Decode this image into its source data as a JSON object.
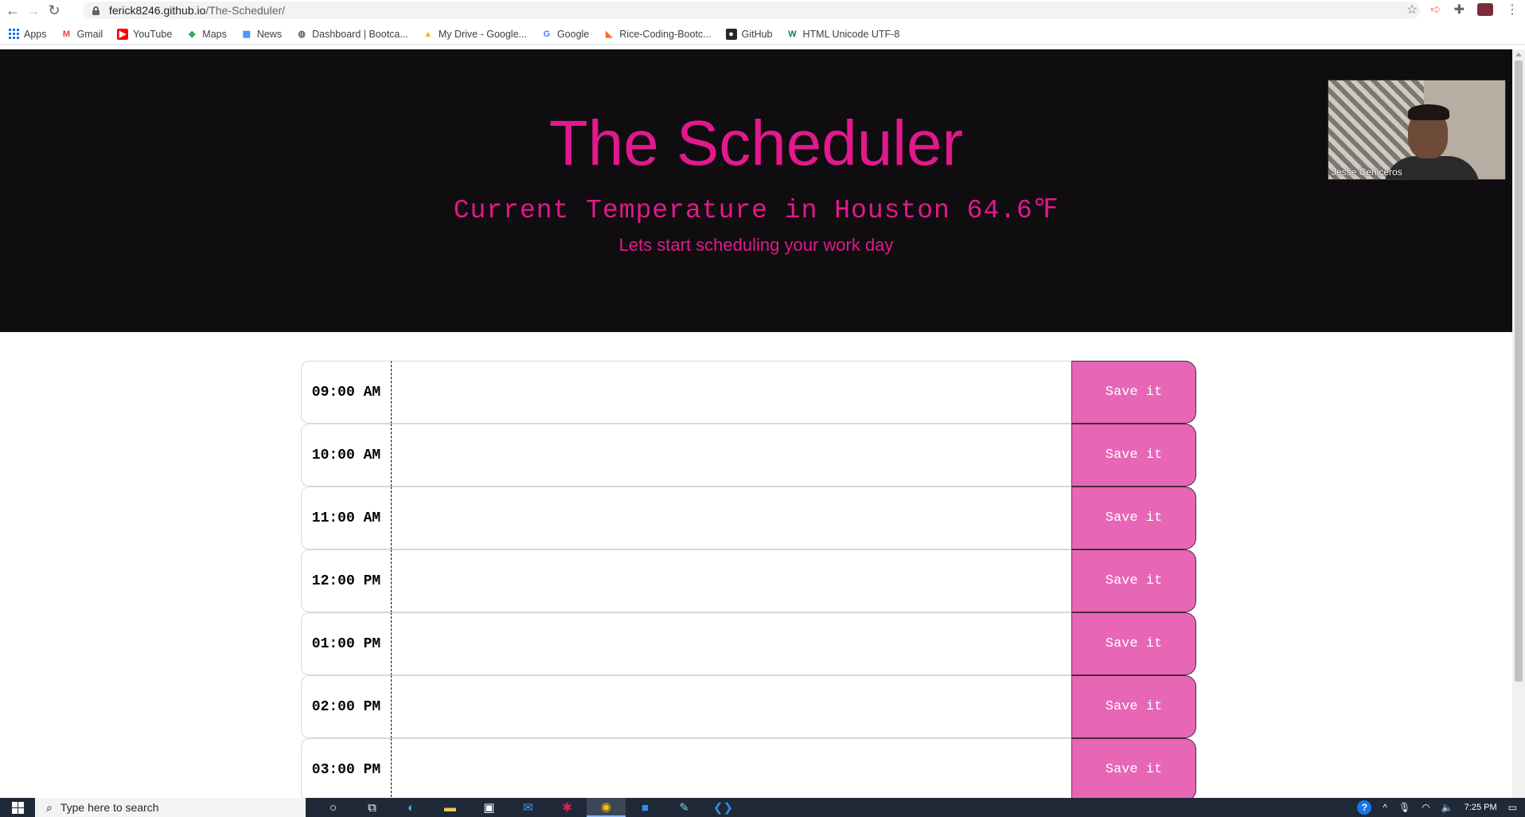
{
  "browser": {
    "url_host": "ferick8246.github.io",
    "url_path": "/The-Scheduler/",
    "bookmarks": [
      {
        "label": "Apps",
        "icon": "apps-grid-icon"
      },
      {
        "label": "Gmail",
        "icon": "gmail-icon"
      },
      {
        "label": "YouTube",
        "icon": "youtube-icon"
      },
      {
        "label": "Maps",
        "icon": "maps-icon"
      },
      {
        "label": "News",
        "icon": "news-icon"
      },
      {
        "label": "Dashboard | Bootca...",
        "icon": "globe-icon"
      },
      {
        "label": "My Drive - Google...",
        "icon": "drive-icon"
      },
      {
        "label": "Google",
        "icon": "google-icon"
      },
      {
        "label": "Rice-Coding-Bootc...",
        "icon": "gitlab-icon"
      },
      {
        "label": "GitHub",
        "icon": "github-icon"
      },
      {
        "label": "HTML Unicode UTF-8",
        "icon": "w3-icon"
      }
    ]
  },
  "header": {
    "title": "The Scheduler",
    "temperature": "Current Temperature in Houston 64.6℉",
    "lead": "Lets start scheduling your work day"
  },
  "video_overlay": {
    "participant_name": "Jesse Ceniceros"
  },
  "scheduler": {
    "save_label": "Save it",
    "hours": [
      "09:00 AM",
      "10:00 AM",
      "11:00 AM",
      "12:00 PM",
      "01:00 PM",
      "02:00 PM",
      "03:00 PM"
    ],
    "descriptions": [
      "",
      "",
      "",
      "",
      "",
      "",
      ""
    ]
  },
  "taskbar": {
    "search_placeholder": "Type here to search",
    "time": "7:25 PM"
  },
  "colors": {
    "accent_pink": "#e3188d",
    "save_button": "#e766b6",
    "jumbotron_bg": "#0f0d0f"
  }
}
